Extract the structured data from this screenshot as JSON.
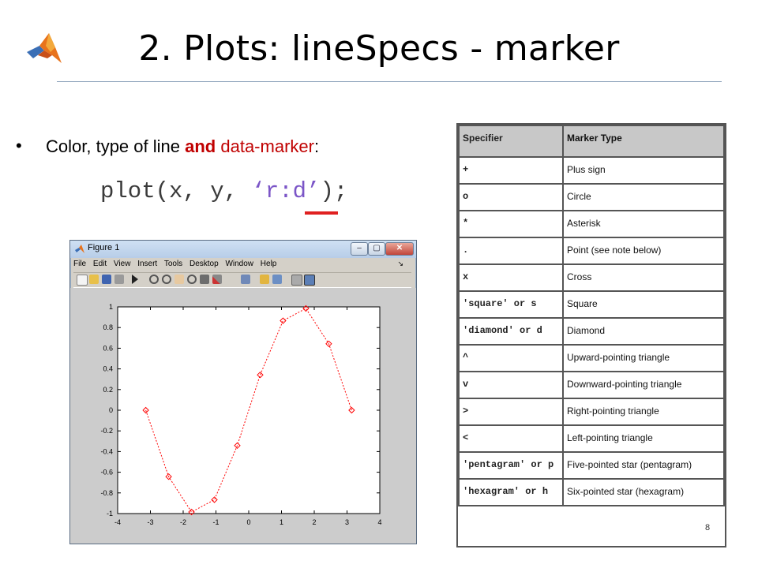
{
  "slide": {
    "title": "2. Plots: lineSpecs - marker",
    "bullet": {
      "prefix": "Color, type of line ",
      "and": "and",
      "middle": " ",
      "data_marker": "data-marker",
      "suffix": ":"
    },
    "code": {
      "before": "plot(x, y, ",
      "spec": "‘r:d’",
      "after": ");"
    },
    "page_number": "8"
  },
  "figure_window": {
    "title": "Figure 1",
    "controls": [
      "–",
      "▢",
      "✕"
    ],
    "menus": [
      "File",
      "Edit",
      "View",
      "Insert",
      "Tools",
      "Desktop",
      "Window",
      "Help"
    ],
    "menu_arrow": "↘"
  },
  "chart_data": {
    "type": "line",
    "title": "",
    "xlabel": "",
    "ylabel": "",
    "xlim": [
      -4,
      4
    ],
    "ylim": [
      -1,
      1
    ],
    "xticks": [
      "-4",
      "-3",
      "-2",
      "-1",
      "0",
      "1",
      "2",
      "3",
      "4"
    ],
    "yticks": [
      "1",
      "0.8",
      "0.6",
      "0.4",
      "0.2",
      "0",
      "-0.2",
      "-0.4",
      "-0.6",
      "-0.8",
      "-1"
    ],
    "grid": false,
    "series": [
      {
        "color": "#ff0000",
        "line_style": "dotted",
        "marker": "diamond",
        "x": [
          -3.1416,
          -2.4435,
          -1.7453,
          -1.0472,
          -0.3491,
          0.3491,
          1.0472,
          1.7453,
          2.4435,
          3.1416
        ],
        "y": [
          0,
          -0.6428,
          -0.9848,
          -0.866,
          -0.342,
          0.342,
          0.866,
          0.9848,
          0.6428,
          0
        ]
      }
    ]
  },
  "marker_table": {
    "headers": [
      "Specifier",
      "Marker Type"
    ],
    "rows": [
      {
        "spec": "+",
        "desc": "Plus sign"
      },
      {
        "spec": "o",
        "desc": "Circle"
      },
      {
        "spec": "*",
        "desc": "Asterisk"
      },
      {
        "spec": ".",
        "desc": "Point (see note below)"
      },
      {
        "spec": "x",
        "desc": "Cross"
      },
      {
        "spec": "'square' or s",
        "desc": "Square"
      },
      {
        "spec": "'diamond' or d",
        "desc": "Diamond"
      },
      {
        "spec": "^",
        "desc": "Upward-pointing triangle"
      },
      {
        "spec": "v",
        "desc": "Downward-pointing triangle"
      },
      {
        "spec": ">",
        "desc": "Right-pointing triangle"
      },
      {
        "spec": "<",
        "desc": "Left-pointing triangle"
      },
      {
        "spec": "'pentagram' or p",
        "desc": "Five-pointed star (pentagram)"
      },
      {
        "spec": "'hexagram' or h",
        "desc": "Six-pointed star (hexagram)"
      }
    ]
  }
}
